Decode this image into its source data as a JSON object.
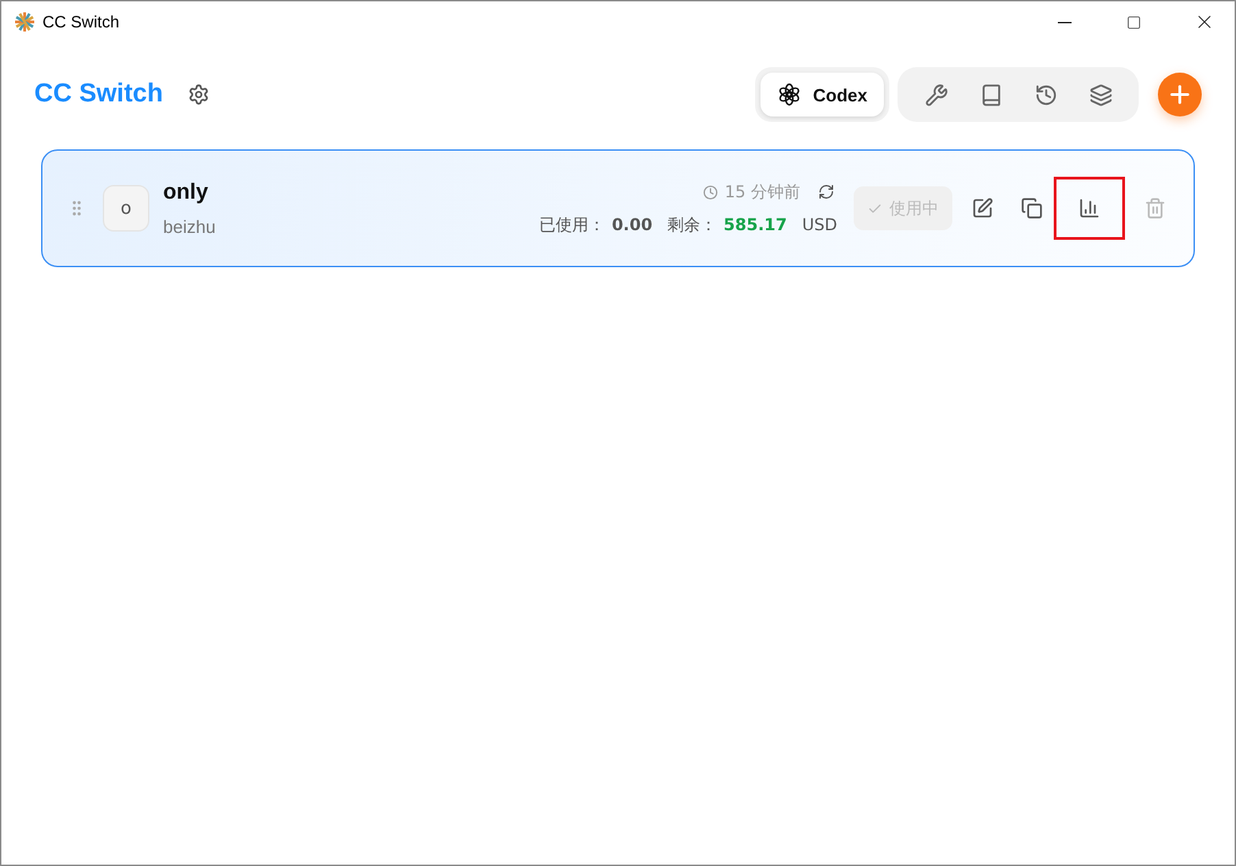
{
  "window": {
    "title": "CC Switch"
  },
  "header": {
    "title": "CC Switch",
    "app_tab": {
      "label": "Codex",
      "selected": true
    },
    "tools": [
      {
        "kind": "wrench"
      },
      {
        "kind": "book"
      },
      {
        "kind": "history"
      },
      {
        "kind": "skills"
      }
    ]
  },
  "providers": [
    {
      "avatar": "o",
      "name": "only",
      "note": "beizhu",
      "active": true,
      "updated": "15 分钟前",
      "used_label": "已使用：",
      "used": "0.00",
      "remaining_label": "剩余：",
      "remaining": "585.17",
      "unit": "USD",
      "use_button": {
        "label": "使用中",
        "disabled": true
      },
      "actions": [
        {
          "kind": "edit",
          "highlighted": false,
          "disabled": false
        },
        {
          "kind": "copy",
          "highlighted": false,
          "disabled": false
        },
        {
          "kind": "stats",
          "highlighted": true,
          "disabled": false
        },
        {
          "kind": "delete",
          "highlighted": false,
          "disabled": true
        }
      ]
    }
  ]
}
